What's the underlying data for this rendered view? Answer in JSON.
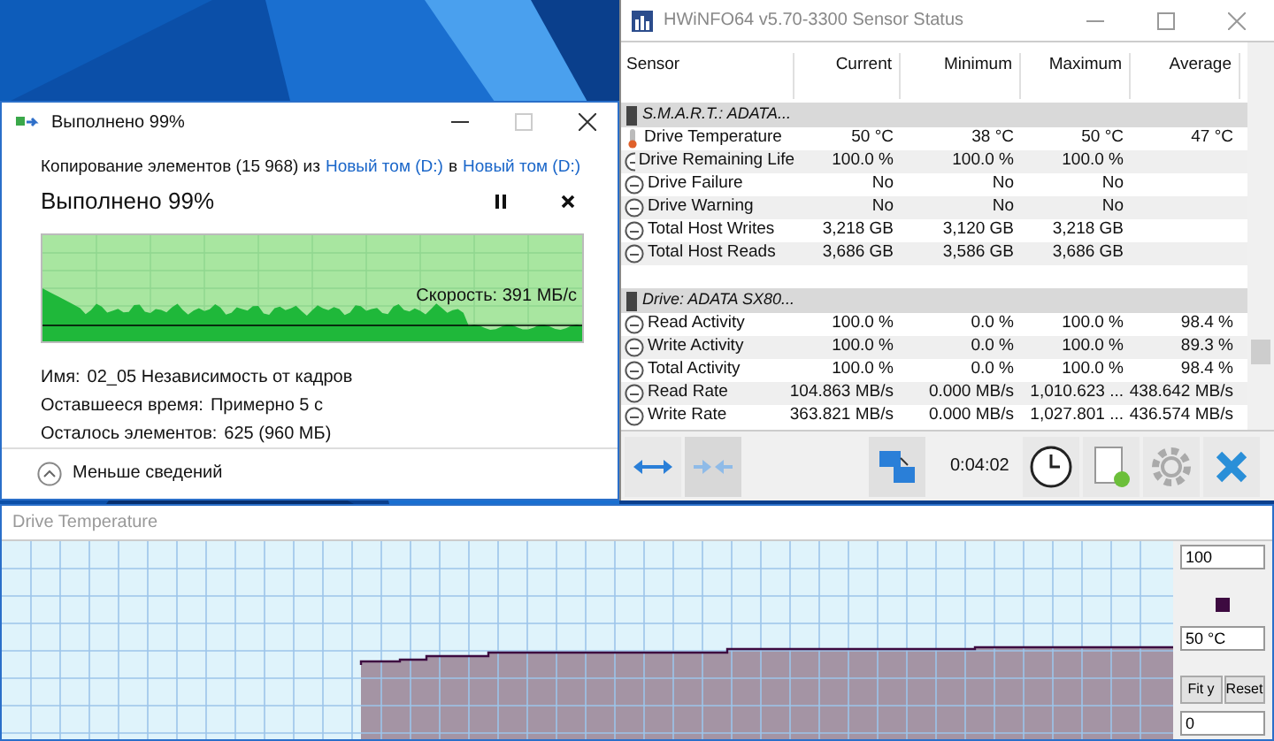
{
  "copy_dialog": {
    "title": "Выполнено 99%",
    "summary": [
      "Копирование элементов (15 968) из",
      "Новый том (D:)",
      "в",
      "Новый том (D:)"
    ],
    "heading": "Выполнено 99%",
    "speed": "Скорость: 391 МБ/с",
    "details": [
      {
        "label": "Имя:",
        "value": "02_05 Независимость от кадров"
      },
      {
        "label": "Оставшееся время:",
        "value": "Примерно 5 с"
      },
      {
        "label": "Осталось элементов:",
        "value": "625 (960 МБ)"
      }
    ],
    "toggle": "Меньше сведений"
  },
  "sensor_window": {
    "title": "HWiNFO64 v5.70-3300 Sensor Status",
    "columns": [
      "Sensor",
      "Current",
      "Minimum",
      "Maximum",
      "Average"
    ],
    "groups": [
      {
        "name": "S.M.A.R.T.: ADATA...",
        "rows": [
          {
            "kind": "temperature",
            "cells": [
              "Drive Temperature",
              "50 °C",
              "38 °C",
              "50 °C",
              "47 °C"
            ]
          },
          {
            "kind": "gauge",
            "cells": [
              "Drive Remaining Life",
              "100.0 %",
              "100.0 %",
              "100.0 %"
            ]
          },
          {
            "kind": "gauge",
            "cells": [
              "Drive Failure",
              "No",
              "No",
              "No"
            ]
          },
          {
            "kind": "gauge",
            "cells": [
              "Drive Warning",
              "No",
              "No",
              "No"
            ]
          },
          {
            "kind": "gauge",
            "cells": [
              "Total Host Writes",
              "3,218 GB",
              "3,120 GB",
              "3,218 GB"
            ]
          },
          {
            "kind": "gauge",
            "cells": [
              "Total Host Reads",
              "3,686 GB",
              "3,586 GB",
              "3,686 GB"
            ]
          }
        ]
      },
      {
        "name": "Drive: ADATA SX80...",
        "rows": [
          {
            "kind": "gauge",
            "cells": [
              "Read Activity",
              "100.0 %",
              "0.0 %",
              "100.0 %",
              "98.4 %"
            ]
          },
          {
            "kind": "gauge",
            "cells": [
              "Write Activity",
              "100.0 %",
              "0.0 %",
              "100.0 %",
              "89.3 %"
            ]
          },
          {
            "kind": "gauge",
            "cells": [
              "Total Activity",
              "100.0 %",
              "0.0 %",
              "100.0 %",
              "98.4 %"
            ]
          },
          {
            "kind": "gauge",
            "cells": [
              "Read Rate",
              "104.863 MB/s",
              "0.000 MB/s",
              "1,010.623 ...",
              "438.642 MB/s"
            ]
          },
          {
            "kind": "gauge",
            "cells": [
              "Write Rate",
              "363.821 MB/s",
              "0.000 MB/s",
              "1,027.801 ...",
              "436.574 MB/s"
            ]
          }
        ]
      }
    ],
    "timer": "0:04:02"
  },
  "graph_window": {
    "title": "Drive Temperature",
    "y_max": "100",
    "current": "50 °C",
    "y_min": "0",
    "color": "#3d0a40",
    "buttons": [
      "Fit y",
      "Reset"
    ]
  }
}
